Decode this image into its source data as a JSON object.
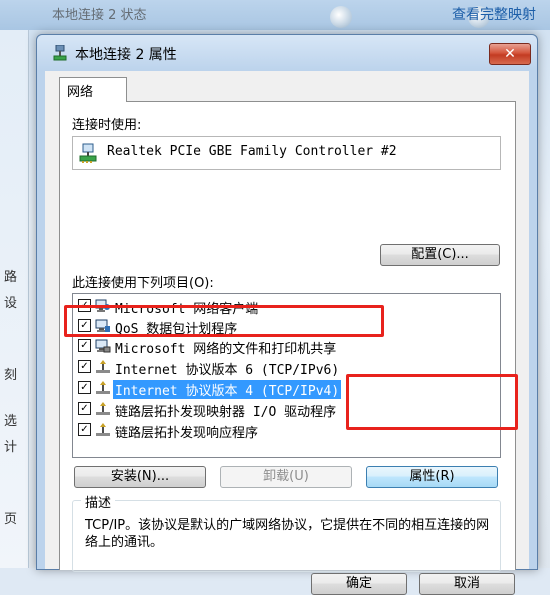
{
  "background": {
    "title": "本地连接 2 状态",
    "right_link": "查看完整映射",
    "side_fragments": [
      "路",
      "设",
      "刻",
      "选",
      "计",
      "页"
    ]
  },
  "dialog": {
    "title": "本地连接 2 属性",
    "close_label": "✕",
    "tab_label": "网络",
    "connect_using_label": "连接时使用:",
    "adapter_name": "Realtek PCIe GBE Family Controller #2",
    "configure_label": "配置(C)...",
    "items_label": "此连接使用下列项目(O):",
    "items": [
      {
        "label": "Microsoft 网络客户端",
        "checked": true,
        "icon": "network-client-icon"
      },
      {
        "label": "QoS 数据包计划程序",
        "checked": true,
        "icon": "qos-scheduler-icon"
      },
      {
        "label": "Microsoft 网络的文件和打印机共享",
        "checked": true,
        "icon": "file-printer-sharing-icon"
      },
      {
        "label": "Internet 协议版本 6 (TCP/IPv6)",
        "checked": true,
        "icon": "protocol-icon"
      },
      {
        "label": "Internet 协议版本 4 (TCP/IPv4)",
        "checked": true,
        "icon": "protocol-icon",
        "selected": true
      },
      {
        "label": "链路层拓扑发现映射器 I/O 驱动程序",
        "checked": true,
        "icon": "protocol-icon"
      },
      {
        "label": "链路层拓扑发现响应程序",
        "checked": true,
        "icon": "protocol-icon"
      }
    ],
    "install_label": "安装(N)...",
    "uninstall_label": "卸载(U)",
    "properties_label": "属性(R)",
    "description_legend": "描述",
    "description_text": "TCP/IP。该协议是默认的广域网络协议，它提供在不同的相互连接的网络上的通讯。",
    "ok_label": "确定",
    "cancel_label": "取消",
    "highlight_color": "#e8221c",
    "selection_color": "#3399ff"
  }
}
